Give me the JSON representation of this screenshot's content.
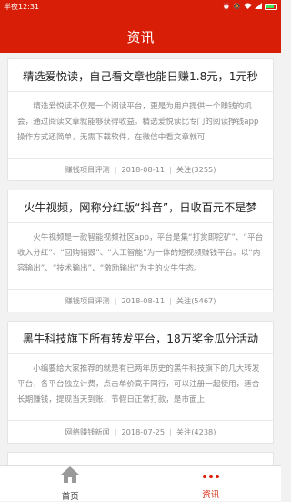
{
  "status_bar": {
    "time": "半夜12:31",
    "battery_label": ""
  },
  "header": {
    "title": "资讯"
  },
  "articles": [
    {
      "title": "精选爱悦读，自己看文章也能日赚1.8元，1元秒",
      "desc": "精选爱悦读不仅是一个阅读平台，更是为用户提供一个赚钱的机会，通过阅读文章就能够获得收益。精选爱悦读比专门的阅读挣钱app操作方式还简单，无需下载软件，在微信中看文章就可",
      "category": "赚钱项目评测",
      "date": "2018-08-11",
      "follows": "关注(3255)"
    },
    {
      "title": "火牛视频，网称分红版“抖音”，日收百元不是梦",
      "desc": "火牛视频是一款智能视频社区app，平台是集“打赏即挖矿”、“平台收入分红”、“回购销毁”、“人工智能”为一体的短视频赚钱平台。以“内容输出”、“技术输出”、“激励输出”为主的火牛生态。",
      "category": "赚钱项目评测",
      "date": "2018-08-11",
      "follows": "关注(5467)"
    },
    {
      "title": "黑牛科技旗下所有转发平台，18万奖金瓜分活动",
      "desc": "小编要给大家推荐的就是有已两年历史的黑牛科技旗下的几大转发平台，各平台独立计费，点击单价高于同行，可以注册一起使用，适合长期赚钱，提现当天到账，节假日正常打款，是市面上",
      "category": "网络赚钱新闻",
      "date": "2018-07-25",
      "follows": "关注(4238)"
    }
  ],
  "tabbar": {
    "home_label": "首页",
    "news_label": "资讯"
  },
  "colors": {
    "brand": "#d81e06"
  }
}
